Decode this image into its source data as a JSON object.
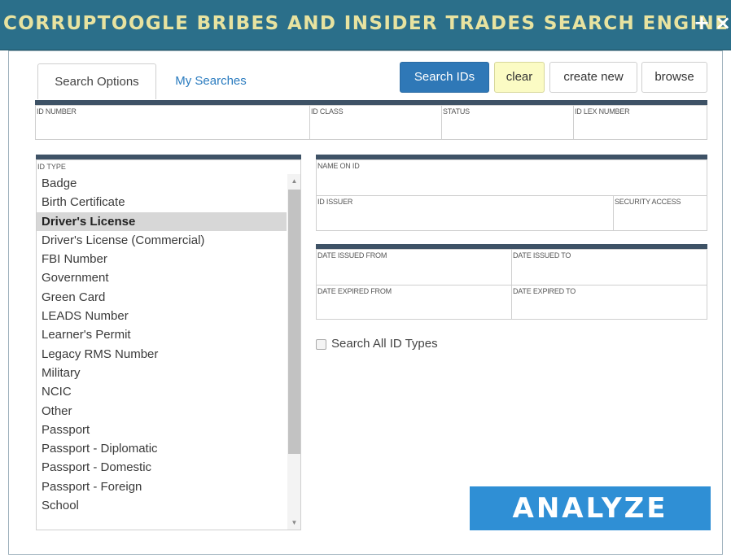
{
  "window": {
    "title": "CORRUPTOOGLE BRIBES AND INSIDER TRADES SEARCH ENGINE",
    "plus_glyph": "+",
    "close_glyph": "×",
    "icons": [
      "plus-icon",
      "close-icon"
    ]
  },
  "tabs": [
    {
      "label": "Search Options",
      "active": true
    },
    {
      "label": "My Searches",
      "active": false
    }
  ],
  "actions": {
    "search_ids": "Search IDs",
    "clear": "clear",
    "create_new": "create new",
    "browse": "browse"
  },
  "fields": {
    "id_number": {
      "label": "ID NUMBER",
      "value": ""
    },
    "id_class": {
      "label": "ID CLASS",
      "value": ""
    },
    "status": {
      "label": "STATUS",
      "value": ""
    },
    "id_lex_number": {
      "label": "ID LEX NUMBER",
      "value": ""
    },
    "name_on_id": {
      "label": "NAME ON ID",
      "value": ""
    },
    "id_issuer": {
      "label": "ID ISSUER",
      "value": ""
    },
    "security_access": {
      "label": "SECURITY ACCESS",
      "value": ""
    },
    "date_issued_from": {
      "label": "DATE ISSUED FROM",
      "value": ""
    },
    "date_issued_to": {
      "label": "DATE ISSUED TO",
      "value": ""
    },
    "date_expired_from": {
      "label": "DATE EXPIRED FROM",
      "value": ""
    },
    "date_expired_to": {
      "label": "DATE EXPIRED TO",
      "value": ""
    }
  },
  "id_type": {
    "label": "ID TYPE",
    "selected": "Driver's License",
    "items": [
      "Badge",
      "Birth Certificate",
      "Driver's License",
      "Driver's License (Commercial)",
      "FBI Number",
      "Government",
      "Green Card",
      "LEADS Number",
      "Learner's Permit",
      "Legacy RMS Number",
      "Military",
      "NCIC",
      "Other",
      "Passport",
      "Passport - Diplomatic",
      "Passport - Domestic",
      "Passport - Foreign",
      "School"
    ]
  },
  "search_all": {
    "label": "Search All ID Types",
    "checked": false
  },
  "analyze": {
    "label": "ANALYZE"
  },
  "colors": {
    "titlebar": "#2b6f8a",
    "title_text": "#e8e3a0",
    "primary": "#2f78b7",
    "analyze": "#2f8fd5",
    "clear_bg": "#fbfbc4",
    "bar": "#3e5266",
    "link": "#2a7bbf"
  }
}
